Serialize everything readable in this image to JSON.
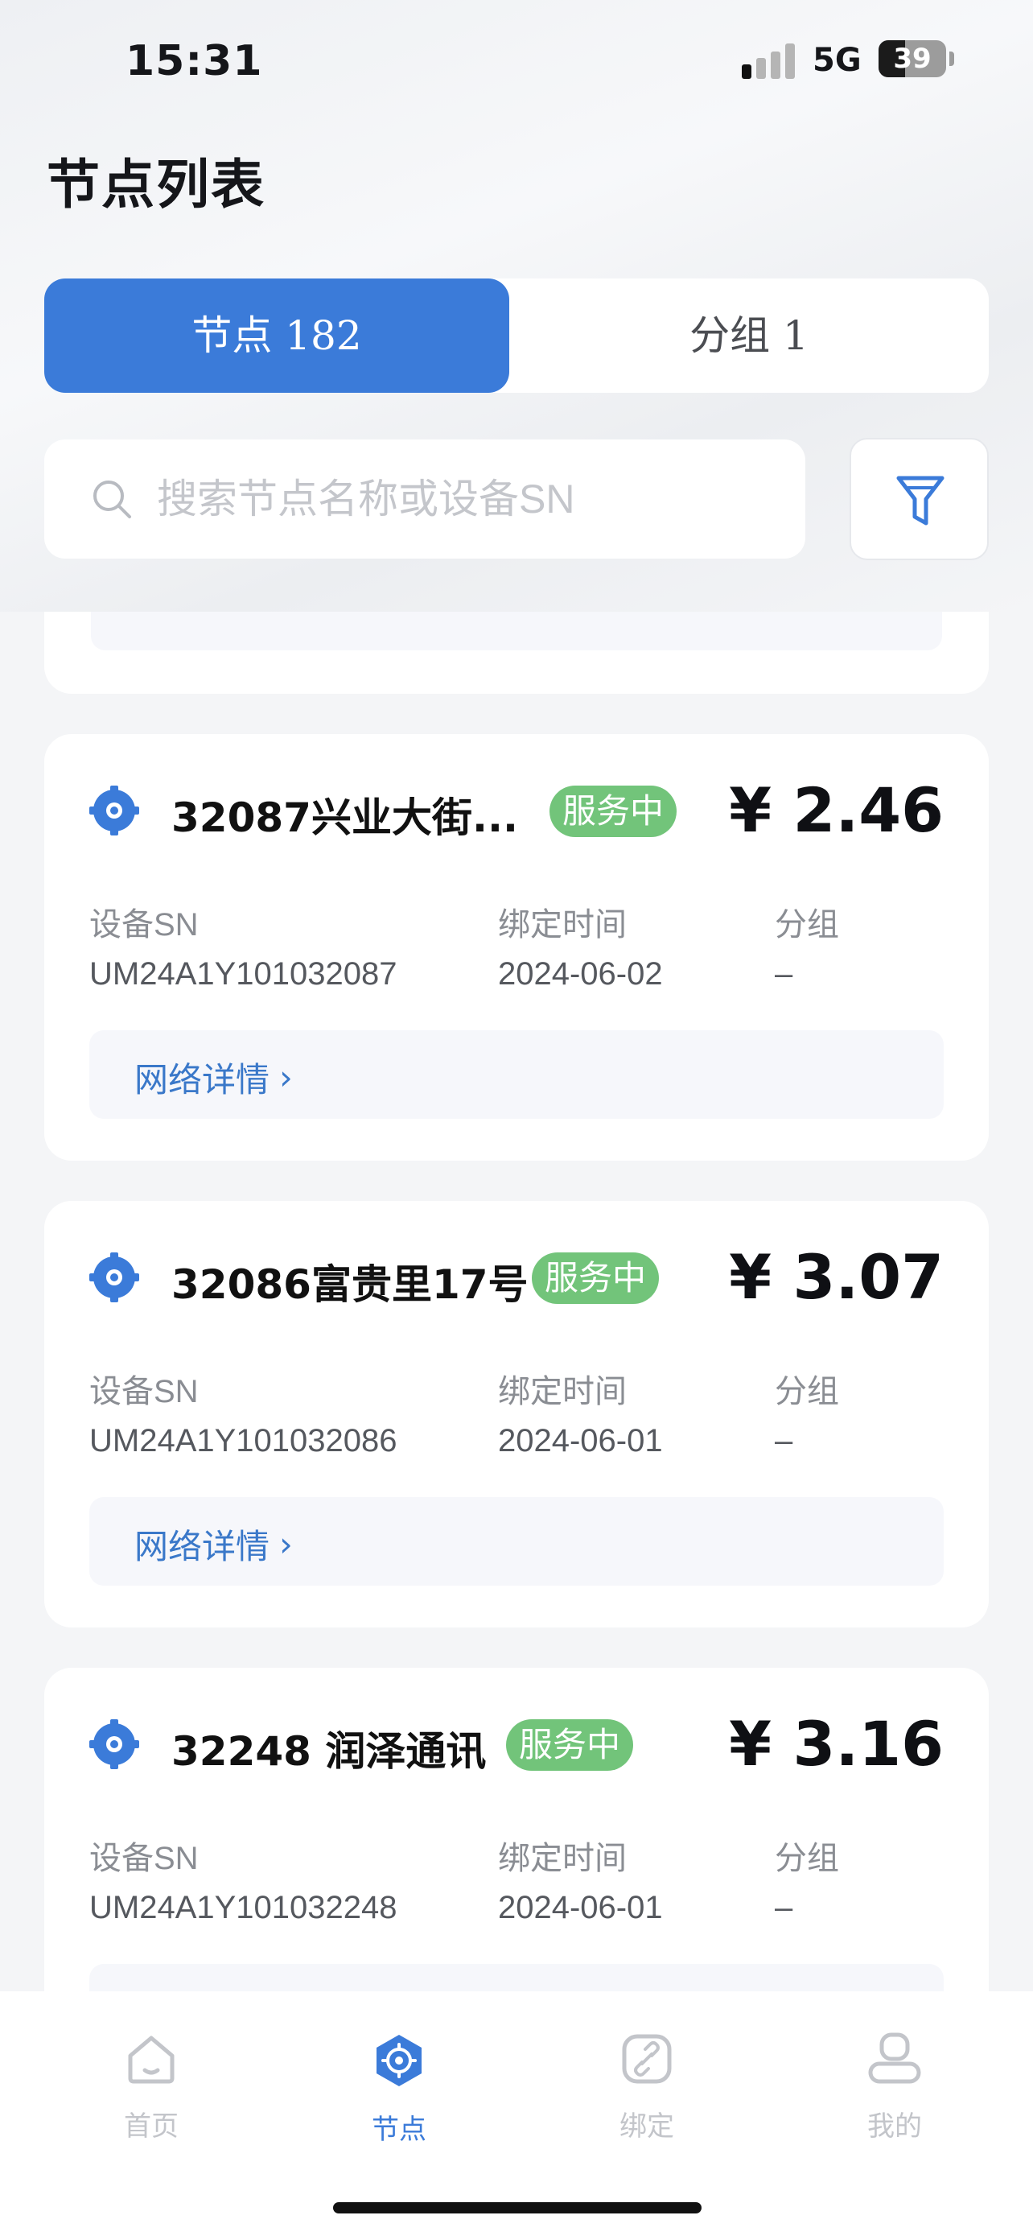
{
  "status_bar": {
    "time": "15:31",
    "network": "5G",
    "battery": "39",
    "battery_level": 0.39
  },
  "page": {
    "title": "节点列表"
  },
  "tabs": [
    {
      "label": "节点 182",
      "active": true
    },
    {
      "label": "分组 1",
      "active": false
    }
  ],
  "search": {
    "placeholder": "搜索节点名称或设备SN",
    "value": "",
    "icon": "search-icon"
  },
  "filter": {
    "icon": "filter-icon"
  },
  "field_labels": {
    "sn": "设备SN",
    "bind_time": "绑定时间",
    "group": "分组",
    "network_details": "网络详情",
    "chevron": "›"
  },
  "nodes": [
    {
      "name": "32087兴业大街...",
      "status": "服务中",
      "price": "¥ 2.46",
      "sn": "UM24A1Y101032087",
      "bind_time": "2024-06-02",
      "group": "–"
    },
    {
      "name": "32086富贵里17号",
      "status": "服务中",
      "price": "¥ 3.07",
      "sn": "UM24A1Y101032086",
      "bind_time": "2024-06-01",
      "group": "–"
    },
    {
      "name": "32248 润泽通讯",
      "status": "服务中",
      "price": "¥ 3.16",
      "sn": "UM24A1Y101032248",
      "bind_time": "2024-06-01",
      "group": "–"
    }
  ],
  "bottom_nav": [
    {
      "label": "首页",
      "icon": "home-icon",
      "active": false
    },
    {
      "label": "节点",
      "icon": "node-icon",
      "active": true
    },
    {
      "label": "绑定",
      "icon": "link-icon",
      "active": false
    },
    {
      "label": "我的",
      "icon": "profile-icon",
      "active": false
    }
  ],
  "colors": {
    "accent": "#3b7bd9",
    "status_green": "#72c47a",
    "background": "#f4f5f7"
  }
}
